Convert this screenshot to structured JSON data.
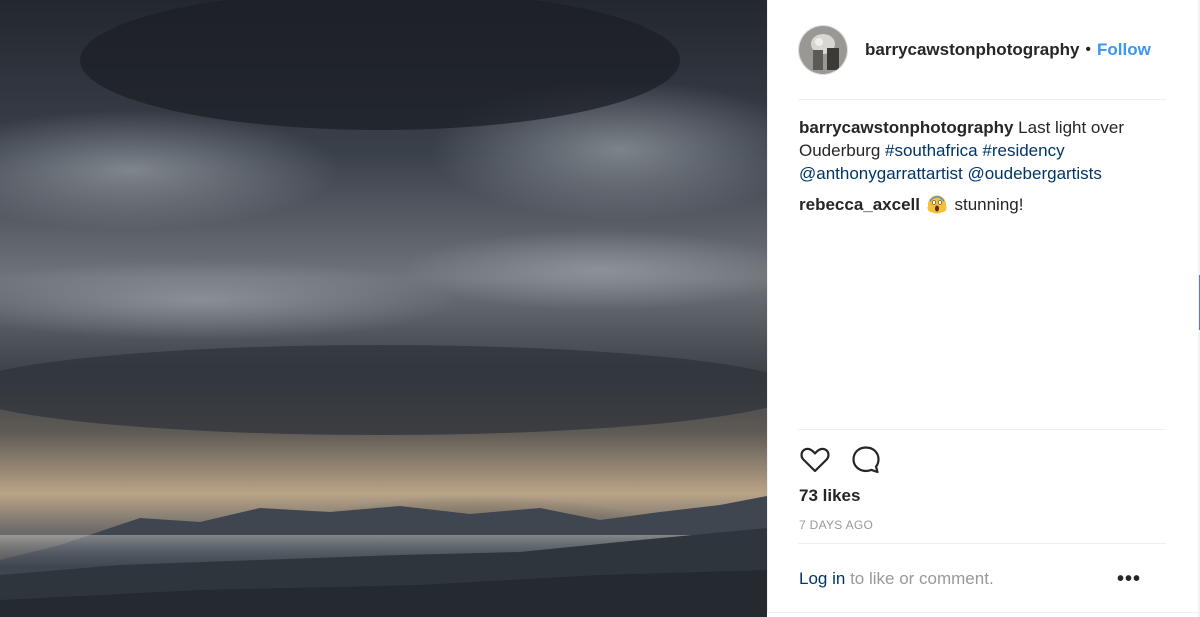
{
  "post": {
    "username": "barrycawstonphotography",
    "bullet": "•",
    "follow_label": "Follow",
    "caption": {
      "username": "barrycawstonphotography",
      "text": "Last light over Ouderburg",
      "hashtags": [
        "#southafrica",
        "#residency"
      ],
      "mentions": [
        "@anthonygarrattartist",
        "@oudebergartists"
      ]
    },
    "comments": [
      {
        "username": "rebecca_axcell",
        "emoji": "screaming-face-emoji",
        "text": "stunning!"
      }
    ],
    "likes_label": "73 likes",
    "age_label": "7 DAYS AGO",
    "login_link": "Log in",
    "login_text": "to like or comment.",
    "more_label": "•••"
  },
  "icons": {
    "like": "heart-outline-icon",
    "comment": "speech-bubble-icon"
  },
  "colors": {
    "link": "#3897f0",
    "tag": "#003569",
    "muted": "#999999",
    "text": "#262626",
    "divider": "#efefef"
  }
}
